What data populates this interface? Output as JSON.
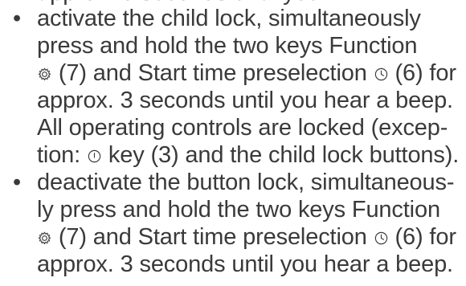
{
  "items": [
    {
      "bullet": "•",
      "lines": [
        {
          "before": "activate the child lock, simultaneously"
        },
        {
          "before": "press and hold the two keys Function"
        },
        {
          "before": "",
          "icon1": "gear-icon",
          "mid": " (7) and Start time preselection ",
          "icon2": "clock-icon",
          "after": " (6) for"
        },
        {
          "before": "approx. 3 seconds until you hear a beep."
        },
        {
          "before": "All operating controls are locked (excep-"
        },
        {
          "before": "tion: ",
          "icon1": "power-icon",
          "mid": " key (3) and the child lock buttons)."
        }
      ]
    },
    {
      "bullet": "•",
      "lines": [
        {
          "before": "deactivate the button lock, simultaneous-"
        },
        {
          "before": "ly press and hold the two keys Function"
        },
        {
          "before": "",
          "icon1": "gear-icon",
          "mid": " (7) and Start time preselection ",
          "icon2": "clock-icon",
          "after": " (6) for"
        },
        {
          "before": "approx. 3 seconds until you hear a beep."
        }
      ]
    }
  ]
}
